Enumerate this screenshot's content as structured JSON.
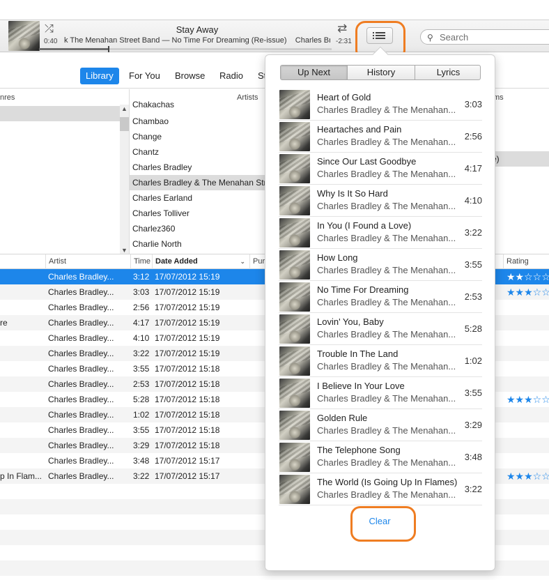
{
  "player": {
    "title": "Stay Away",
    "subtitle": "k The Menahan Street Band — No Time For Dreaming (Re-issue)",
    "subtitle_artist": "Charles Bradley",
    "elapsed": "0:40",
    "remaining": "-2:31",
    "progress": 0.238
  },
  "search": {
    "placeholder": "Search"
  },
  "nav": {
    "tabs": [
      "Library",
      "For You",
      "Browse",
      "Radio",
      "St"
    ]
  },
  "browser": {
    "genres_header": "nres",
    "artists_header": "Artists",
    "albums_header": "ms",
    "artists": [
      "Chakachas",
      "Chambao",
      "Change",
      "Chantz",
      "Charles Bradley",
      "Charles Bradley & The Menahan Stree",
      "Charles Earland",
      "Charles Tolliver",
      "Charlez360",
      "Charlie North"
    ],
    "album_selected": "e)"
  },
  "table": {
    "headers": {
      "artist": "Artist",
      "time": "Time",
      "date": "Date Added",
      "purchased": "Purc",
      "rating": "Rating"
    },
    "rows": [
      {
        "name": "",
        "artist": "Charles Bradley...",
        "time": "3:12",
        "date": "17/07/2012 15:19",
        "rating": "★★☆☆☆"
      },
      {
        "name": "",
        "artist": "Charles Bradley...",
        "time": "3:03",
        "date": "17/07/2012 15:19",
        "rating": "★★★☆☆"
      },
      {
        "name": "",
        "artist": "Charles Bradley...",
        "time": "2:56",
        "date": "17/07/2012 15:19",
        "rating": ""
      },
      {
        "name": "re",
        "artist": "Charles Bradley...",
        "time": "4:17",
        "date": "17/07/2012 15:19",
        "rating": ""
      },
      {
        "name": "",
        "artist": "Charles Bradley...",
        "time": "4:10",
        "date": "17/07/2012 15:19",
        "rating": ""
      },
      {
        "name": "",
        "artist": "Charles Bradley...",
        "time": "3:22",
        "date": "17/07/2012 15:19",
        "rating": ""
      },
      {
        "name": "",
        "artist": "Charles Bradley...",
        "time": "3:55",
        "date": "17/07/2012 15:18",
        "rating": ""
      },
      {
        "name": "",
        "artist": "Charles Bradley...",
        "time": "2:53",
        "date": "17/07/2012 15:18",
        "rating": ""
      },
      {
        "name": "",
        "artist": "Charles Bradley...",
        "time": "5:28",
        "date": "17/07/2012 15:18",
        "rating": "★★★☆☆"
      },
      {
        "name": "",
        "artist": "Charles Bradley...",
        "time": "1:02",
        "date": "17/07/2012 15:18",
        "rating": ""
      },
      {
        "name": "",
        "artist": "Charles Bradley...",
        "time": "3:55",
        "date": "17/07/2012 15:18",
        "rating": ""
      },
      {
        "name": "",
        "artist": "Charles Bradley...",
        "time": "3:29",
        "date": "17/07/2012 15:18",
        "rating": ""
      },
      {
        "name": "",
        "artist": "Charles Bradley...",
        "time": "3:48",
        "date": "17/07/2012 15:17",
        "rating": ""
      },
      {
        "name": "p In Flam...",
        "artist": "Charles Bradley...",
        "time": "3:22",
        "date": "17/07/2012 15:17",
        "rating": "★★★☆☆"
      }
    ]
  },
  "upnext": {
    "tabs": [
      "Up Next",
      "History",
      "Lyrics"
    ],
    "items": [
      {
        "title": "Heart of Gold",
        "artist": "Charles Bradley & The Menahan...",
        "duration": "3:03"
      },
      {
        "title": "Heartaches and Pain",
        "artist": "Charles Bradley & The Menahan...",
        "duration": "2:56"
      },
      {
        "title": "Since Our Last Goodbye",
        "artist": "Charles Bradley & The Menahan...",
        "duration": "4:17"
      },
      {
        "title": "Why Is It So Hard",
        "artist": "Charles Bradley & The Menahan...",
        "duration": "4:10"
      },
      {
        "title": "In You (I Found a Love)",
        "artist": "Charles Bradley & The Menahan...",
        "duration": "3:22"
      },
      {
        "title": "How Long",
        "artist": "Charles Bradley & The Menahan...",
        "duration": "3:55"
      },
      {
        "title": "No Time For Dreaming",
        "artist": "Charles Bradley & The Menahan...",
        "duration": "2:53"
      },
      {
        "title": "Lovin' You, Baby",
        "artist": "Charles Bradley & The Menahan...",
        "duration": "5:28"
      },
      {
        "title": "Trouble In The Land",
        "artist": "Charles Bradley & The Menahan...",
        "duration": "1:02"
      },
      {
        "title": "I Believe In Your Love",
        "artist": "Charles Bradley & The Menahan...",
        "duration": "3:55"
      },
      {
        "title": "Golden Rule",
        "artist": "Charles Bradley & The Menahan...",
        "duration": "3:29"
      },
      {
        "title": "The Telephone Song",
        "artist": "Charles Bradley & The Menahan...",
        "duration": "3:48"
      },
      {
        "title": "The World (Is Going Up In Flames)",
        "artist": "Charles Bradley & The Menahan...",
        "duration": "3:22"
      }
    ],
    "clear_label": "Clear"
  },
  "colors": {
    "accent": "#1d86ea",
    "highlight": "#ef7d22"
  }
}
